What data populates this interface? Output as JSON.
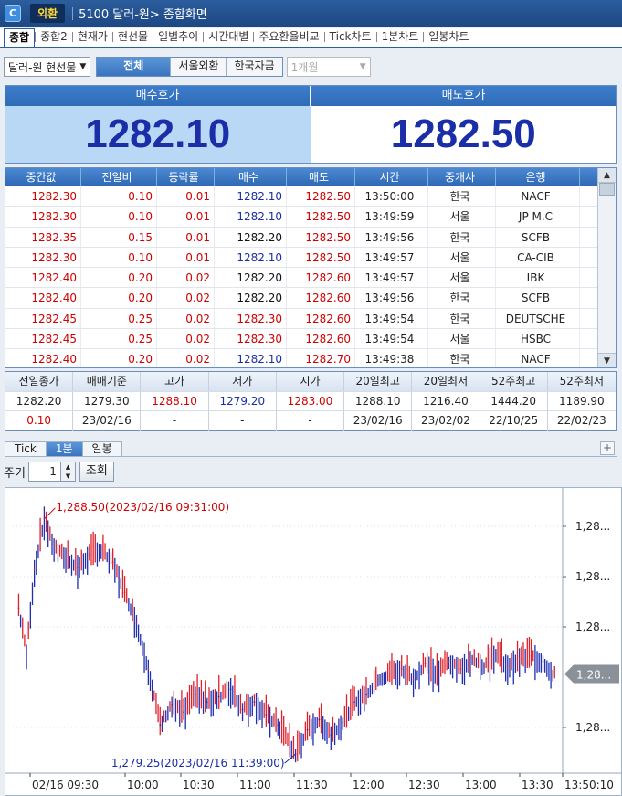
{
  "app": {
    "badge": "외환",
    "screen_title": "5100 달러-원> 종합화면"
  },
  "tabs": [
    "종합",
    "종합2",
    "현재가",
    "현선물",
    "일별추이",
    "시간대별",
    "주요환율비교",
    "Tick차트",
    "1분차트",
    "일봉차트"
  ],
  "controls": {
    "instrument": "달러-원 현선물",
    "segments": [
      "전체",
      "서울외환",
      "한국자금"
    ],
    "period_select": "1개월"
  },
  "quote": {
    "bid_label": "매수호가",
    "ask_label": "매도호가",
    "bid": "1282.10",
    "ask": "1282.50"
  },
  "trades": {
    "columns": [
      "중간값",
      "전일비",
      "등락률",
      "매수",
      "매도",
      "시간",
      "중개사",
      "은행"
    ],
    "rows": [
      {
        "mid": "1282.30",
        "chg": "0.10",
        "pct": "0.01",
        "buy": "1282.10",
        "buy_color": "blue",
        "sell": "1282.50",
        "time": "13:50:00",
        "broker": "한국",
        "bank": "NACF"
      },
      {
        "mid": "1282.30",
        "chg": "0.10",
        "pct": "0.01",
        "buy": "1282.10",
        "buy_color": "blue",
        "sell": "1282.50",
        "time": "13:49:59",
        "broker": "서울",
        "bank": "JP M.C"
      },
      {
        "mid": "1282.35",
        "chg": "0.15",
        "pct": "0.01",
        "buy": "1282.20",
        "buy_color": "black",
        "sell": "1282.50",
        "time": "13:49:56",
        "broker": "한국",
        "bank": "SCFB"
      },
      {
        "mid": "1282.30",
        "chg": "0.10",
        "pct": "0.01",
        "buy": "1282.10",
        "buy_color": "blue",
        "sell": "1282.50",
        "time": "13:49:57",
        "broker": "서울",
        "bank": "CA-CIB"
      },
      {
        "mid": "1282.40",
        "chg": "0.20",
        "pct": "0.02",
        "buy": "1282.20",
        "buy_color": "black",
        "sell": "1282.60",
        "time": "13:49:57",
        "broker": "서울",
        "bank": "IBK"
      },
      {
        "mid": "1282.40",
        "chg": "0.20",
        "pct": "0.02",
        "buy": "1282.20",
        "buy_color": "black",
        "sell": "1282.60",
        "time": "13:49:56",
        "broker": "한국",
        "bank": "SCFB"
      },
      {
        "mid": "1282.45",
        "chg": "0.25",
        "pct": "0.02",
        "buy": "1282.30",
        "buy_color": "red",
        "sell": "1282.60",
        "time": "13:49:54",
        "broker": "한국",
        "bank": "DEUTSCHE"
      },
      {
        "mid": "1282.45",
        "chg": "0.25",
        "pct": "0.02",
        "buy": "1282.30",
        "buy_color": "red",
        "sell": "1282.60",
        "time": "13:49:54",
        "broker": "서울",
        "bank": "HSBC"
      },
      {
        "mid": "1282.40",
        "chg": "0.20",
        "pct": "0.02",
        "buy": "1282.10",
        "buy_color": "blue",
        "sell": "1282.70",
        "time": "13:49:38",
        "broker": "한국",
        "bank": "NACF"
      }
    ]
  },
  "stats": {
    "headers": [
      "전일종가",
      "매매기준",
      "고가",
      "저가",
      "시가",
      "20일최고",
      "20일최저",
      "52주최고",
      "52주최저"
    ],
    "row1": [
      "1282.20",
      "1279.30",
      "1288.10",
      "1279.20",
      "1283.00",
      "1288.10",
      "1216.40",
      "1444.20",
      "1189.90"
    ],
    "row1_colors": [
      "black",
      "black",
      "red",
      "blue",
      "red",
      "black",
      "black",
      "black",
      "black"
    ],
    "row2": [
      "0.10",
      "23/02/16",
      "-",
      "-",
      "-",
      "23/02/16",
      "23/02/02",
      "22/10/25",
      "22/02/23"
    ],
    "row2_colors": [
      "red",
      "black",
      "black",
      "black",
      "black",
      "black",
      "black",
      "black",
      "black"
    ]
  },
  "chart_tabs": [
    "Tick",
    "1분",
    "일봉"
  ],
  "period": {
    "label": "주기",
    "value": "1",
    "query_button": "조회"
  },
  "chart_data": {
    "type": "line",
    "high_label": "1,288.50(2023/02/16 09:31:00)",
    "low_label": "1,279.25(2023/02/16 11:39:00)",
    "y_tick_labels": [
      "1,28...",
      "1,28...",
      "1,28...",
      "1,28..."
    ],
    "current_label": "1,28...",
    "x_tick_labels": [
      "02/16 09:30",
      "10:00",
      "10:30",
      "11:00",
      "11:30",
      "12:00",
      "12:30",
      "13:00",
      "13:30",
      "13:50:10"
    ],
    "x": [
      "09:18",
      "09:22",
      "09:26",
      "09:31",
      "09:36",
      "09:42",
      "09:48",
      "09:54",
      "10:00",
      "10:06",
      "10:12",
      "10:18",
      "10:24",
      "10:30",
      "10:36",
      "10:42",
      "10:48",
      "10:54",
      "11:00",
      "11:06",
      "11:12",
      "11:18",
      "11:24",
      "11:30",
      "11:39",
      "11:45",
      "11:51",
      "11:57",
      "12:03",
      "12:09",
      "12:15",
      "12:21",
      "12:27",
      "12:33",
      "12:39",
      "12:45",
      "12:51",
      "12:57",
      "13:03",
      "13:09",
      "13:15",
      "13:21",
      "13:27",
      "13:33",
      "13:39",
      "13:45",
      "13:50"
    ],
    "y": [
      1285.0,
      1283.2,
      1286.5,
      1288.5,
      1287.4,
      1287.0,
      1286.6,
      1287.1,
      1287.3,
      1286.8,
      1285.6,
      1284.4,
      1282.6,
      1280.4,
      1281.2,
      1280.9,
      1281.6,
      1281.3,
      1281.5,
      1281.8,
      1281.0,
      1281.3,
      1280.8,
      1280.4,
      1279.25,
      1280.2,
      1280.6,
      1280.0,
      1280.5,
      1281.3,
      1281.6,
      1282.2,
      1282.4,
      1282.6,
      1282.2,
      1282.8,
      1282.4,
      1282.9,
      1282.6,
      1283.0,
      1282.7,
      1283.2,
      1282.7,
      1283.0,
      1283.1,
      1282.9,
      1282.4
    ],
    "ylim": [
      1278.5,
      1289.5
    ],
    "xlim": [
      "09:15",
      "13:55"
    ]
  }
}
